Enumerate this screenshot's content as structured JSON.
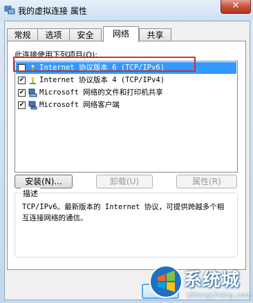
{
  "window": {
    "title": "我的虚拟连接 属性",
    "close_glyph": "✕"
  },
  "tabs": [
    {
      "label": "常规"
    },
    {
      "label": "选项"
    },
    {
      "label": "安全"
    },
    {
      "label": "网络",
      "active": true
    },
    {
      "label": "共享"
    }
  ],
  "network": {
    "items_label": "此连接使用下列项目(O):",
    "items": [
      {
        "label": "Internet 协议版本 6 (TCP/IPv6)",
        "checked": false,
        "selected": true,
        "icon": "network-protocol-icon"
      },
      {
        "label": "Internet 协议版本 4 (TCP/IPv4)",
        "checked": true,
        "selected": false,
        "icon": "network-protocol-icon"
      },
      {
        "label": "Microsoft 网络的文件和打印机共享",
        "checked": true,
        "selected": false,
        "icon": "file-printer-share-icon"
      },
      {
        "label": "Microsoft 网络客户端",
        "checked": true,
        "selected": false,
        "icon": "network-client-icon"
      }
    ],
    "buttons": {
      "install": "安装(N)...",
      "uninstall": "卸载(U)",
      "properties": "属性(R)"
    },
    "description": {
      "legend": "描述",
      "text": "TCP/IPv6。最新版本的 Internet 协议，可提供跨越多个相互连接网络的通信。"
    }
  },
  "footer": {
    "ok_partial": "定"
  },
  "watermark": {
    "brand_cn": "系统城",
    "brand_en": "xitongcheng.com"
  },
  "colors": {
    "selection": "#3399ff",
    "highlight_box": "#c8322e",
    "title_bar": "#cddff3"
  }
}
